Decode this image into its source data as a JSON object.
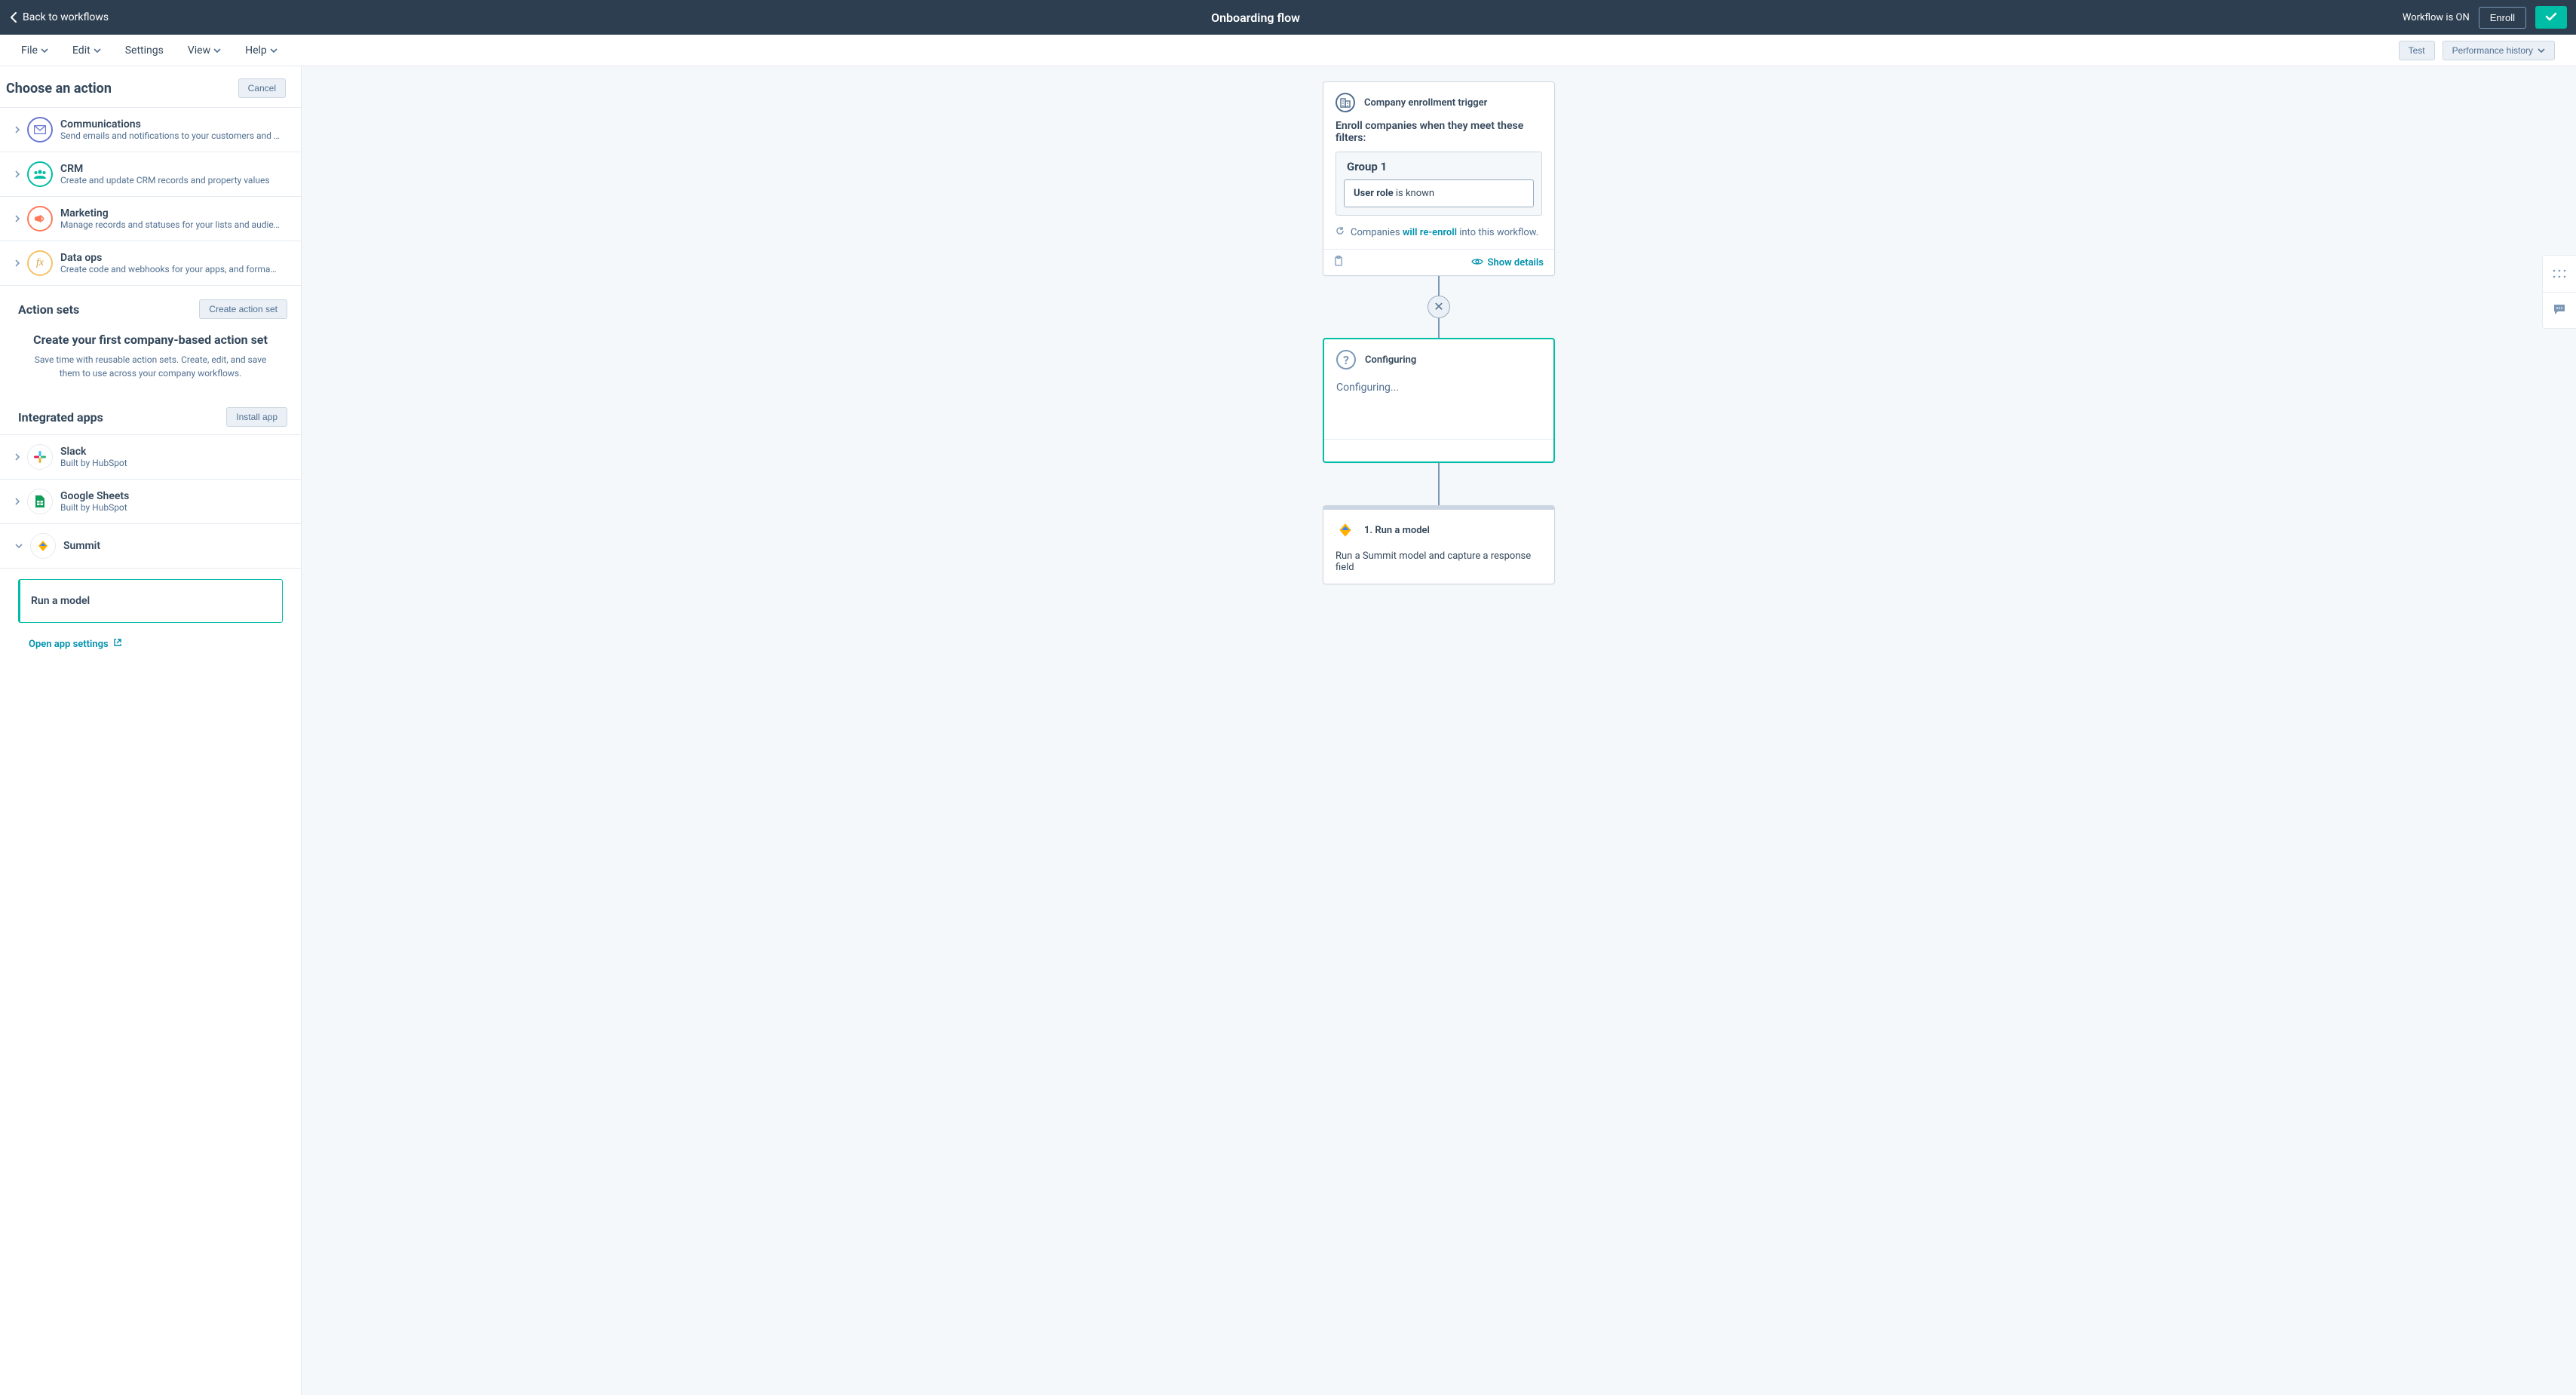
{
  "topbar": {
    "back": "Back to workflows",
    "title": "Onboarding flow",
    "status": "Workflow is ON",
    "enroll": "Enroll"
  },
  "menubar": {
    "items": [
      "File",
      "Edit",
      "Settings",
      "View",
      "Help"
    ],
    "test": "Test",
    "perf": "Performance history"
  },
  "sidebar": {
    "title": "Choose an action",
    "cancel": "Cancel",
    "categories": [
      {
        "title": "Communications",
        "desc": "Send emails and notifications to your customers and …"
      },
      {
        "title": "CRM",
        "desc": "Create and update CRM records and property values"
      },
      {
        "title": "Marketing",
        "desc": "Manage records and statuses for your lists and audie…"
      },
      {
        "title": "Data ops",
        "desc": "Create code and webhooks for your apps, and forma…"
      }
    ],
    "actionSets": {
      "title": "Action sets",
      "create": "Create action set",
      "emptyTitle": "Create your first company-based action set",
      "emptyDesc": "Save time with reusable action sets. Create, edit, and save them to use across your company workflows."
    },
    "apps": {
      "title": "Integrated apps",
      "install": "Install app",
      "items": [
        {
          "name": "Slack",
          "by": "Built by HubSpot"
        },
        {
          "name": "Google Sheets",
          "by": "Built by HubSpot"
        },
        {
          "name": "Summit"
        }
      ],
      "summitAction": "Run a model",
      "openSettings": "Open app settings"
    }
  },
  "canvas": {
    "trigger": {
      "title": "Company enrollment trigger",
      "desc": "Enroll companies when they meet these filters:",
      "groupTitle": "Group 1",
      "ruleField": "User role",
      "ruleOp": " is known",
      "reenrollPre": "Companies ",
      "reenrollHl": "will re-enroll",
      "reenrollPost": " into this workflow.",
      "showDetails": "Show details"
    },
    "config": {
      "title": "Configuring",
      "body": "Configuring..."
    },
    "run": {
      "title": "1. Run a model",
      "desc": "Run a Summit model and capture a response field"
    }
  }
}
